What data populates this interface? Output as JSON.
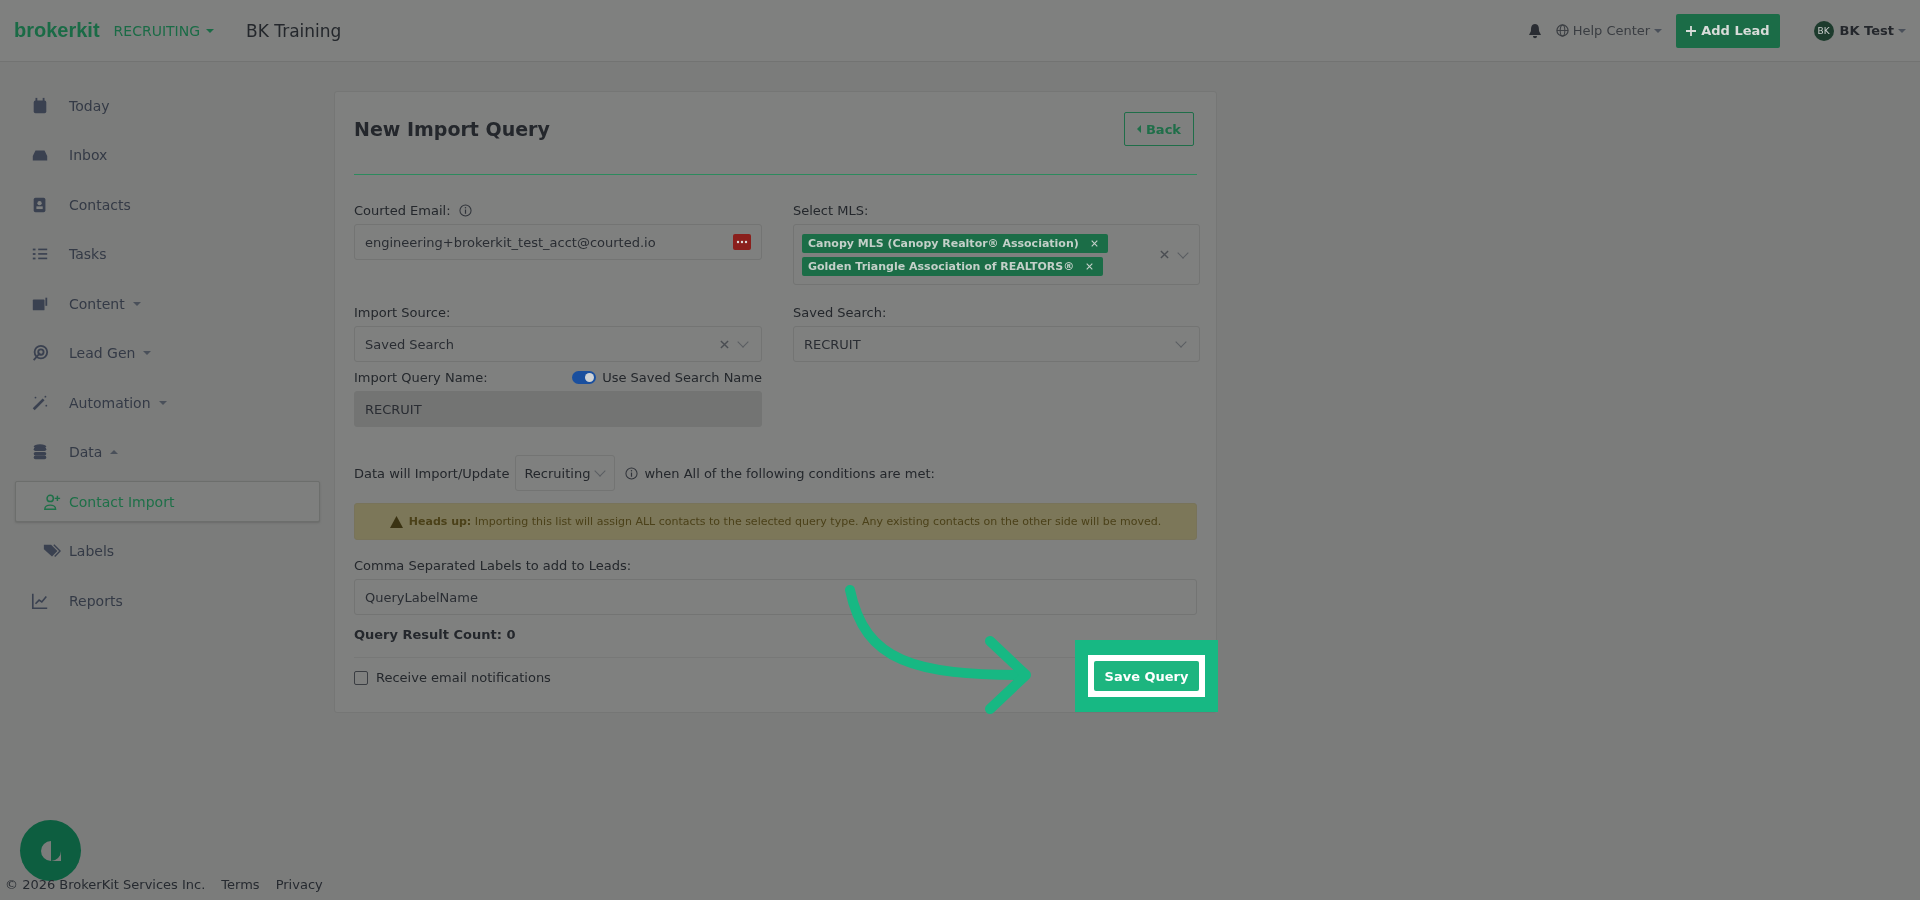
{
  "topbar": {
    "logo": "brokerkit",
    "mode": "RECRUITING",
    "team": "BK Training",
    "help": "Help Center",
    "add_lead": "Add Lead",
    "avatar": "BK",
    "user": "BK Test"
  },
  "sidebar": {
    "items": [
      {
        "kind": "link",
        "label": "Today",
        "selected": false
      },
      {
        "kind": "link",
        "label": "Inbox",
        "selected": false
      },
      {
        "kind": "link",
        "label": "Contacts",
        "selected": false
      },
      {
        "kind": "link",
        "label": "Tasks",
        "selected": false
      },
      {
        "kind": "group",
        "label": "Content",
        "expanded": false,
        "selected": false
      },
      {
        "kind": "group",
        "label": "Lead Gen",
        "expanded": false,
        "selected": false
      },
      {
        "kind": "group",
        "label": "Automation",
        "expanded": false,
        "selected": false
      },
      {
        "kind": "group",
        "label": "Data",
        "expanded": true,
        "selected": false,
        "children": [
          {
            "label": "Contact Import",
            "selected": true
          },
          {
            "label": "Labels",
            "selected": false
          }
        ]
      },
      {
        "kind": "link",
        "label": "Reports",
        "selected": false
      }
    ]
  },
  "form": {
    "title": "New Import Query",
    "back": "Back",
    "email_label": "Courted Email:",
    "email_value": "engineering+brokerkit_test_acct@courted.io",
    "mls_label": "Select MLS:",
    "mls_tags": [
      "Canopy MLS (Canopy Realtor® Association)",
      "Golden Triangle Association of REALTORS®"
    ],
    "source_label": "Import Source:",
    "source_value": "Saved Search",
    "saved_label": "Saved Search:",
    "saved_value": "RECRUIT",
    "name_label": "Import Query Name:",
    "toggle_label": "Use Saved Search Name",
    "toggle_on": true,
    "name_value": "RECRUIT",
    "import_prefix": "Data will Import/Update",
    "import_type": "Recruiting",
    "import_suffix": "when All of the following conditions are met:",
    "warning": "**Heads up:** Importing this list will assign ALL contacts to the selected query type. Any existing contacts on the other side will be moved.",
    "labels_label": "Comma Separated Labels to add to Leads:",
    "labels_value": "QueryLabelName",
    "count": "Query Result Count: 0",
    "notify_label": "Receive email notifications",
    "notify_checked": false,
    "save": "Save Query"
  },
  "footer": {
    "copyright": "© 2026 BrokerKit Services Inc.",
    "links": [
      "Terms",
      "Privacy"
    ]
  }
}
